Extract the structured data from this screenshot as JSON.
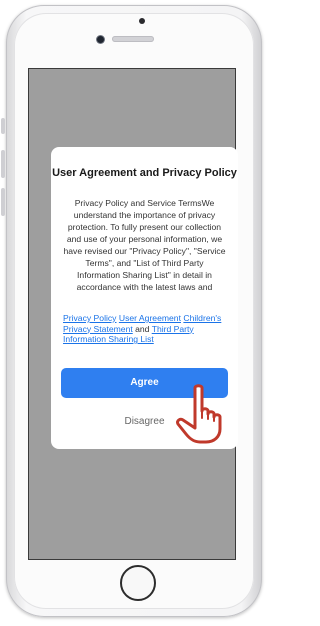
{
  "dialog": {
    "title": "User Agreement and Privacy Policy",
    "body": "Privacy Policy and Service TermsWe understand the importance of privacy protection. To fully present our collection and use of your personal information, we have revised our \"Privacy Policy\", \"Service Terms\", and \"List of Third Party Information Sharing List\" in detail in accordance with the latest laws and",
    "links": {
      "privacy_policy": "Privacy Policy",
      "user_agreement": "User Agreement",
      "childrens_privacy": "Children's Privacy Statement",
      "and_text": "and",
      "third_party": "Third Party Information Sharing List"
    },
    "agree_label": "Agree",
    "disagree_label": "Disagree"
  },
  "colors": {
    "accent": "#2f7ff0",
    "link": "#1a73e8",
    "overlay": "#9e9e9e",
    "hand_outline": "#c0392b"
  },
  "icons": {
    "pointer": "pointing-hand-icon"
  }
}
